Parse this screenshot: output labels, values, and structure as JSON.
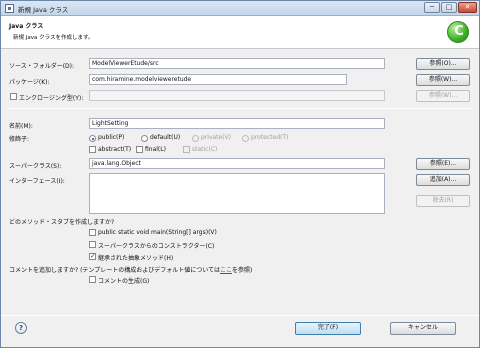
{
  "window": {
    "title": "新規 Java クラス",
    "controls": [
      "─",
      "□",
      "✕"
    ]
  },
  "header": {
    "title": "Java クラス",
    "description": "新規 Java クラスを作成します。"
  },
  "form": {
    "source_folder": {
      "label": "ソース・フォルダー(D):",
      "value": "ModelViewerEtude/src",
      "button": "参照(O)..."
    },
    "package": {
      "label": "パッケージ(K):",
      "value": "com.hiramine.modelvieweretude",
      "button": "参照(W)..."
    },
    "enclosing_type": {
      "label": "エンクロージング型(Y):",
      "value": "",
      "button": "参照(W)..."
    },
    "name": {
      "label": "名前(M):",
      "value": "LightSetting"
    },
    "modifiers": {
      "label": "修飾子:",
      "radios": [
        "public(P)",
        "default(U)",
        "private(V)",
        "protected(T)"
      ],
      "checkboxes": [
        "abstract(T)",
        "final(L)",
        "static(C)"
      ]
    },
    "superclass": {
      "label": "スーパークラス(S):",
      "value": "java.lang.Object",
      "button": "参照(E)..."
    },
    "interfaces": {
      "label": "インターフェース(I):",
      "add_button": "追加(A)...",
      "remove_button": "除去(R)"
    },
    "stubs": {
      "question": "どのメソッド・スタブを作成しますか?",
      "options": [
        {
          "label": "public static void main(String[] args)(V)",
          "checked": false
        },
        {
          "label": "スーパークラスからのコンストラクター(C)",
          "checked": false
        },
        {
          "label": "継承された抽象メソッド(H)",
          "checked": true
        }
      ]
    },
    "comments": {
      "question_prefix": "コメントを追加しますか? (テンプレートの構成およびデフォルト値については",
      "question_link": "ここ",
      "question_suffix": "を参照)",
      "option": "コメントの生成(G)"
    }
  },
  "footer": {
    "help": "?",
    "finish_button": "完了(F)",
    "cancel_button": "キャンセル"
  },
  "colors": {
    "title_bar": "#c9d9ec",
    "accent_green": "#3fae2a",
    "link": "#1f57c7"
  }
}
